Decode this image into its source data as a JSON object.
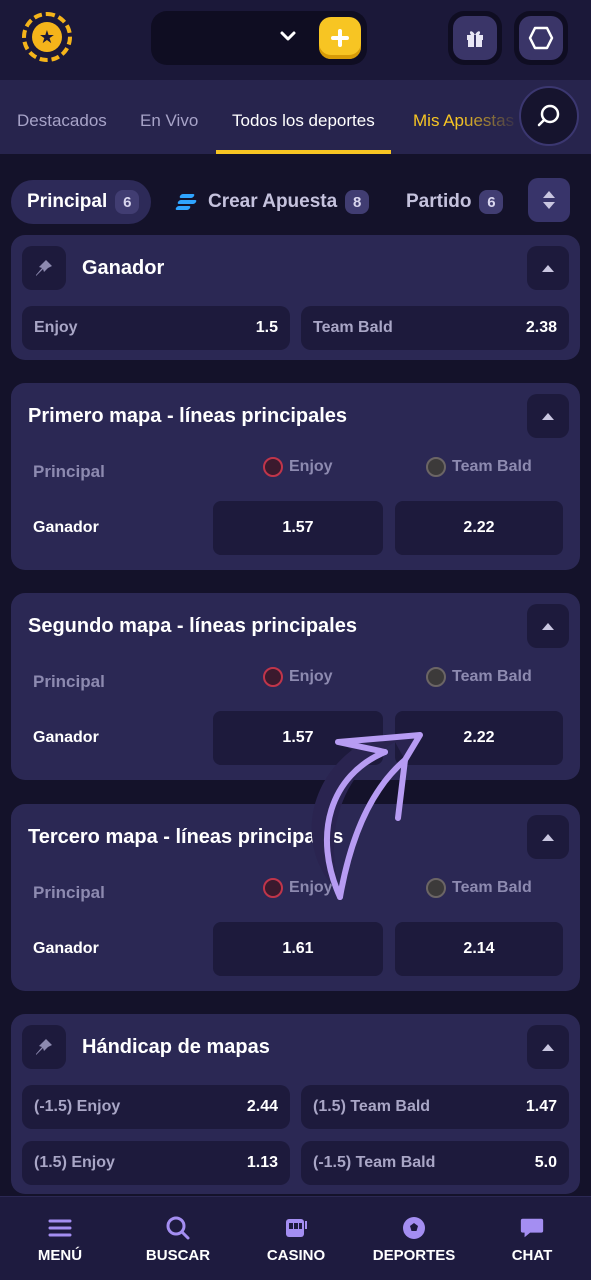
{
  "header": {
    "logo_icon": "star-badge-icon",
    "dropdown_icon": "chevron-down-icon",
    "deposit_icon": "plus-icon",
    "gift_icon": "gift-icon",
    "account_icon": "hexagon-icon",
    "accent_color": "#f7c523"
  },
  "nav_tabs": [
    {
      "label": "Destacados",
      "active": false
    },
    {
      "label": "En Vivo",
      "active": false
    },
    {
      "label": "Todos los deportes",
      "active": true
    },
    {
      "label": "Mis Apuestas",
      "active": false
    }
  ],
  "search_icon": "search-icon",
  "filters": {
    "principal": {
      "label": "Principal",
      "count": "6"
    },
    "crear_apuesta": {
      "label": "Crear Apuesta",
      "count": "8"
    },
    "partido": {
      "label": "Partido",
      "count": "6"
    }
  },
  "markets": {
    "ganador": {
      "title": "Ganador",
      "outcomes": [
        {
          "name": "Enjoy",
          "odds": "1.5"
        },
        {
          "name": "Team Bald",
          "odds": "2.38"
        }
      ]
    },
    "map1": {
      "title": "Primero mapa - líneas principales",
      "section": "Principal",
      "team1": "Enjoy",
      "team2": "Team Bald",
      "row_label": "Ganador",
      "odds1": "1.57",
      "odds2": "2.22"
    },
    "map2": {
      "title": "Segundo mapa - líneas principales",
      "section": "Principal",
      "team1": "Enjoy",
      "team2": "Team Bald",
      "row_label": "Ganador",
      "odds1": "1.57",
      "odds2": "2.22"
    },
    "map3": {
      "title": "Tercero mapa - líneas principales",
      "section": "Principal",
      "team1": "Enjoy",
      "team2": "Team Bald",
      "row_label": "Ganador",
      "odds1": "1.61",
      "odds2": "2.14"
    },
    "handicap": {
      "title": "Hándicap de mapas",
      "outcomes": [
        {
          "name": "(-1.5) Enjoy",
          "odds": "2.44"
        },
        {
          "name": "(1.5) Team Bald",
          "odds": "1.47"
        },
        {
          "name": "(1.5) Enjoy",
          "odds": "1.13"
        },
        {
          "name": "(-1.5) Team Bald",
          "odds": "5.0"
        }
      ]
    }
  },
  "bottom_nav": [
    {
      "label": "MENÚ",
      "icon": "hamburger-icon"
    },
    {
      "label": "BUSCAR",
      "icon": "search-icon"
    },
    {
      "label": "CASINO",
      "icon": "slot-machine-icon"
    },
    {
      "label": "DEPORTES",
      "icon": "soccer-ball-icon"
    },
    {
      "label": "CHAT",
      "icon": "chat-bubble-icon"
    }
  ]
}
